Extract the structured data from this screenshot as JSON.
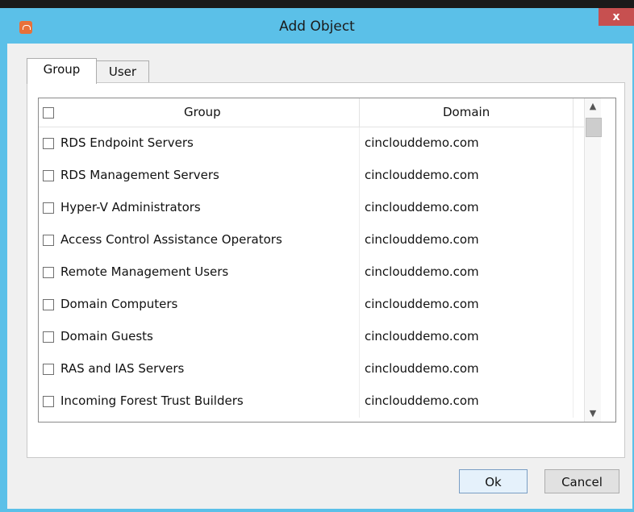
{
  "window": {
    "title": "Add Object",
    "close_label": "x"
  },
  "tabs": [
    {
      "label": "Group",
      "active": true
    },
    {
      "label": "User",
      "active": false
    }
  ],
  "grid": {
    "columns": [
      "Group",
      "Domain"
    ],
    "rows": [
      {
        "group": "RDS Endpoint Servers",
        "domain": "cinclouddemo.com",
        "checked": false
      },
      {
        "group": "RDS Management Servers",
        "domain": "cinclouddemo.com",
        "checked": false
      },
      {
        "group": "Hyper-V Administrators",
        "domain": "cinclouddemo.com",
        "checked": false
      },
      {
        "group": "Access Control Assistance Operators",
        "domain": "cinclouddemo.com",
        "checked": false
      },
      {
        "group": "Remote Management Users",
        "domain": "cinclouddemo.com",
        "checked": false
      },
      {
        "group": "Domain Computers",
        "domain": "cinclouddemo.com",
        "checked": false
      },
      {
        "group": "Domain Guests",
        "domain": "cinclouddemo.com",
        "checked": false
      },
      {
        "group": "RAS and IAS Servers",
        "domain": "cinclouddemo.com",
        "checked": false
      },
      {
        "group": "Incoming Forest Trust Builders",
        "domain": "cinclouddemo.com",
        "checked": false
      }
    ]
  },
  "buttons": {
    "ok": "Ok",
    "cancel": "Cancel"
  },
  "colors": {
    "titlebar": "#5bc0e8",
    "close": "#c75050",
    "app_icon": "#e8713a"
  },
  "icons": {
    "app": "app-logo-icon",
    "close": "close-icon",
    "scroll_up": "chevron-up-icon",
    "scroll_down": "chevron-down-icon"
  }
}
